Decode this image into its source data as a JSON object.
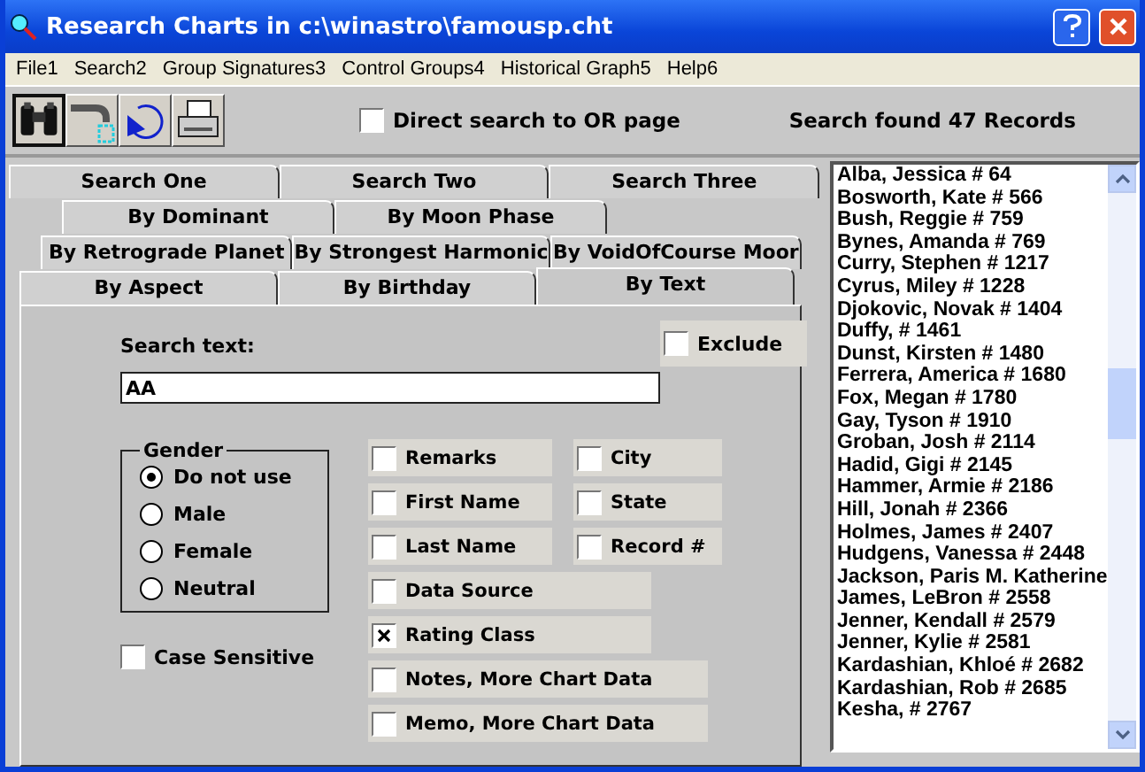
{
  "window": {
    "title": "Research Charts in c:\\winastro\\famousp.cht"
  },
  "menu": [
    "File1",
    "Search2",
    "Group Signatures3",
    "Control Groups4",
    "Historical Graph5",
    "Help6"
  ],
  "toolbar": {
    "direct_search": {
      "label": "Direct search to OR page",
      "checked": false
    },
    "status": "Search found 47 Records"
  },
  "tab_rows": [
    [
      {
        "label": "Search One",
        "selected": false
      },
      {
        "label": "Search Two",
        "selected": false
      },
      {
        "label": "Search Three",
        "selected": false
      }
    ],
    [
      {
        "label": "By Dominant",
        "selected": false
      },
      {
        "label": "By Moon Phase",
        "selected": false
      }
    ],
    [
      {
        "label": "By Retrograde Planet",
        "selected": false
      },
      {
        "label": "By Strongest Harmonic",
        "selected": false
      },
      {
        "label": "By VoidOfCourse Moor",
        "selected": false
      }
    ],
    [
      {
        "label": "By Aspect",
        "selected": false
      },
      {
        "label": "By Birthday",
        "selected": false
      },
      {
        "label": "By Text",
        "selected": true
      }
    ]
  ],
  "search": {
    "label": "Search text:",
    "value": "AA",
    "exclude": {
      "label": "Exclude",
      "checked": false
    }
  },
  "gender": {
    "title": "Gender",
    "options": [
      {
        "label": "Do not use",
        "selected": true
      },
      {
        "label": "Male",
        "selected": false
      },
      {
        "label": "Female",
        "selected": false
      },
      {
        "label": "Neutral",
        "selected": false
      }
    ]
  },
  "case_sensitive": {
    "label": "Case Sensitive",
    "checked": false
  },
  "fields": [
    {
      "label": "Remarks",
      "checked": false
    },
    {
      "label": "City",
      "checked": false
    },
    {
      "label": "First Name",
      "checked": false
    },
    {
      "label": "State",
      "checked": false
    },
    {
      "label": "Last Name",
      "checked": false
    },
    {
      "label": "Record #",
      "checked": false
    },
    {
      "label": "Data Source",
      "checked": false
    },
    {
      "label": "Rating Class",
      "checked": true
    },
    {
      "label": "Notes, More Chart Data",
      "checked": false
    },
    {
      "label": "Memo, More Chart Data",
      "checked": false
    }
  ],
  "results": [
    "Alba, Jessica  # 64",
    "Bosworth, Kate  # 566",
    "Bush, Reggie  # 759",
    "Bynes, Amanda  # 769",
    "Curry, Stephen  # 1217",
    "Cyrus, Miley  # 1228",
    "Djokovic, Novak  # 1404",
    "Duffy,   # 1461",
    "Dunst, Kirsten  # 1480",
    "Ferrera, America  # 1680",
    "Fox, Megan  # 1780",
    "Gay, Tyson  # 1910",
    "Groban, Josh  # 2114",
    "Hadid, Gigi  # 2145",
    "Hammer, Armie  # 2186",
    "Hill, Jonah  # 2366",
    "Holmes, James  # 2407",
    "Hudgens, Vanessa  # 2448",
    "Jackson, Paris M. Katherine",
    "James, LeBron  # 2558",
    "Jenner, Kendall  # 2579",
    "Jenner, Kylie  # 2581",
    "Kardashian, Khloé  # 2682",
    "Kardashian, Rob  # 2685",
    "Kesha,   # 2767"
  ]
}
